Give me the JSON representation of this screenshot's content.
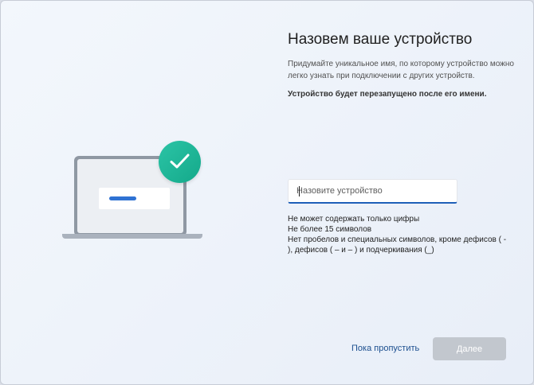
{
  "page": {
    "title": "Назовем ваше устройство",
    "subtitle": "Придумайте уникальное имя, по которому устройство можно легко узнать при подключении с других устройств.",
    "notice": "Устройство будет перезапущено после его имени."
  },
  "name_input": {
    "value": "",
    "placeholder": "Назовите устройство"
  },
  "rules": [
    "Не может содержать только цифры",
    "Не более 15 символов",
    "Нет пробелов и специальных символов, кроме дефисов ( - ), дефисов ( – и – ) и подчеркивания (_)"
  ],
  "actions": {
    "skip_label": "Пока пропустить",
    "next_label": "Далее",
    "next_enabled": false
  },
  "illustration": {
    "laptop_icon": "laptop-icon",
    "badge_icon": "checkmark-icon",
    "badge_color": "#1ab395",
    "accent_bar_color": "#2f72d3"
  },
  "colors": {
    "link": "#1c4f8f",
    "input_underline": "#1e5fb8",
    "disabled_button": "#c2c7ce"
  }
}
